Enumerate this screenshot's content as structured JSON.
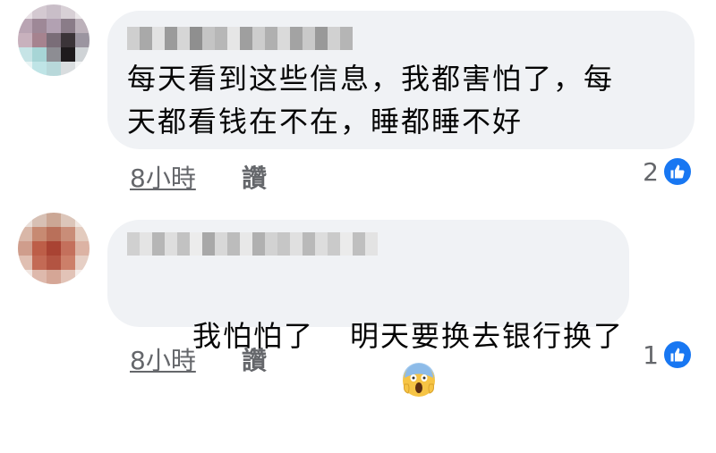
{
  "comments": [
    {
      "text_line1": "每天看到这些信息，我都害怕了，每",
      "text_line2": "天都看钱在不在，睡都睡不好",
      "time": "8小時",
      "like_label": "讚",
      "reaction_count": "2"
    },
    {
      "text_before_emoji": "我怕怕了",
      "emoji": "face-screaming-in-fear",
      "text_after_emoji": "明天要换去银行换了",
      "time": "8小時",
      "like_label": "讚",
      "reaction_count": "1"
    }
  ],
  "colors": {
    "bubble": "#f0f2f5",
    "meta_text": "#65676b",
    "like_blue": "#1877f2"
  },
  "icons": [
    "like-thumb-icon",
    "face-screaming-in-fear-emoji"
  ]
}
